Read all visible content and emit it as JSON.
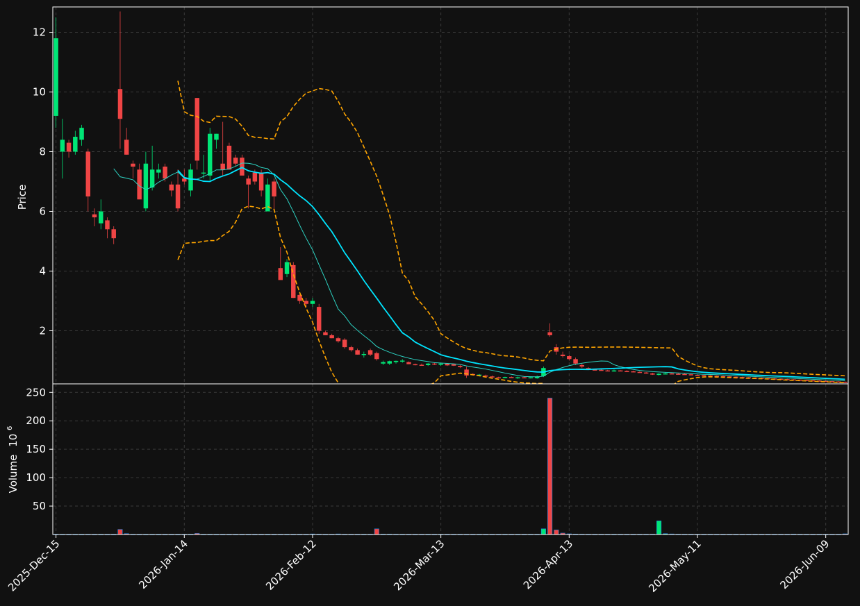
{
  "colors": {
    "background": "#111111",
    "up": "#00e676",
    "down": "#f04545",
    "ma_fast": "#2dd4c4",
    "ma_slow": "#00e5ff",
    "band": "#ffa500",
    "grid": "#3a3a3a",
    "text": "#ffffff",
    "volume_edge": "#1e88e5"
  },
  "chart_data": {
    "type": "candlestick",
    "ylabel": "Price",
    "volume_label": "Volume",
    "volume_exponent_label": "10",
    "volume_exponent_power": "6",
    "x_ticks": [
      {
        "i": 0,
        "label": "2025-Dec-15"
      },
      {
        "i": 20,
        "label": "2026-Jan-14"
      },
      {
        "i": 40,
        "label": "2026-Feb-12"
      },
      {
        "i": 60,
        "label": "2026-Mar-13"
      },
      {
        "i": 80,
        "label": "2026-Apr-13"
      },
      {
        "i": 100,
        "label": "2026-May-11"
      },
      {
        "i": 120,
        "label": "2026-Jun-09"
      }
    ],
    "x_range": [
      -0.5,
      123.5
    ],
    "price_ylim": [
      0.22,
      12.85
    ],
    "price_ticks": [
      2,
      4,
      6,
      8,
      10,
      12
    ],
    "volume_ylim": [
      0,
      265
    ],
    "volume_ticks": [
      50,
      100,
      150,
      200,
      250
    ],
    "grid": true,
    "ohlc": [
      [
        9.2,
        12.5,
        8.8,
        11.8
      ],
      [
        8.0,
        9.1,
        7.1,
        8.4
      ],
      [
        8.3,
        8.4,
        7.8,
        8.0
      ],
      [
        8.0,
        8.7,
        7.9,
        8.5
      ],
      [
        8.4,
        8.9,
        8.2,
        8.8
      ],
      [
        8.0,
        8.1,
        6.0,
        6.5
      ],
      [
        5.9,
        6.1,
        5.5,
        5.8
      ],
      [
        5.6,
        6.4,
        5.4,
        6.0
      ],
      [
        5.7,
        5.8,
        5.1,
        5.4
      ],
      [
        5.4,
        5.5,
        4.9,
        5.1
      ],
      [
        10.1,
        12.7,
        8.1,
        9.1
      ],
      [
        8.4,
        8.8,
        7.9,
        7.9
      ],
      [
        7.6,
        7.7,
        7.1,
        7.5
      ],
      [
        7.4,
        7.6,
        6.5,
        6.4
      ],
      [
        6.1,
        8.0,
        6.0,
        7.6
      ],
      [
        6.8,
        8.2,
        6.7,
        7.4
      ],
      [
        7.3,
        7.6,
        7.1,
        7.4
      ],
      [
        7.5,
        7.6,
        7.0,
        7.1
      ],
      [
        6.9,
        7.0,
        6.5,
        6.7
      ],
      [
        6.9,
        7.4,
        6.0,
        6.1
      ],
      [
        7.1,
        7.4,
        6.9,
        7.0
      ],
      [
        6.7,
        7.6,
        6.5,
        7.4
      ],
      [
        9.8,
        9.8,
        7.4,
        7.7
      ],
      [
        7.3,
        7.9,
        7.1,
        7.3
      ],
      [
        7.2,
        8.8,
        7.0,
        8.6
      ],
      [
        8.4,
        8.6,
        8.1,
        8.6
      ],
      [
        7.6,
        9.0,
        7.2,
        7.4
      ],
      [
        8.2,
        8.3,
        7.4,
        7.4
      ],
      [
        7.8,
        7.9,
        7.5,
        7.6
      ],
      [
        7.8,
        7.9,
        7.2,
        7.2
      ],
      [
        7.1,
        7.2,
        6.1,
        6.9
      ],
      [
        7.3,
        7.4,
        6.9,
        7.0
      ],
      [
        7.3,
        7.4,
        6.5,
        6.7
      ],
      [
        6.0,
        7.1,
        6.0,
        6.9
      ],
      [
        7.0,
        7.1,
        6.0,
        6.5
      ],
      [
        4.1,
        4.8,
        3.8,
        3.7
      ],
      [
        3.9,
        4.4,
        3.8,
        4.3
      ],
      [
        4.2,
        4.3,
        3.1,
        3.1
      ],
      [
        3.2,
        3.3,
        2.9,
        3.0
      ],
      [
        3.0,
        3.1,
        2.8,
        2.9
      ],
      [
        2.9,
        3.1,
        2.8,
        3.0
      ],
      [
        2.8,
        2.9,
        1.9,
        2.0
      ],
      [
        1.95,
        2.0,
        1.85,
        1.85
      ],
      [
        1.85,
        1.9,
        1.75,
        1.75
      ],
      [
        1.75,
        1.8,
        1.6,
        1.65
      ],
      [
        1.7,
        1.75,
        1.4,
        1.45
      ],
      [
        1.45,
        1.5,
        1.3,
        1.35
      ],
      [
        1.35,
        1.4,
        1.2,
        1.2
      ],
      [
        1.2,
        1.3,
        1.1,
        1.22
      ],
      [
        1.35,
        1.4,
        1.15,
        1.2
      ],
      [
        1.25,
        1.3,
        1.0,
        1.05
      ],
      [
        0.9,
        1.0,
        0.85,
        0.95
      ],
      [
        0.9,
        1.0,
        0.85,
        0.98
      ],
      [
        0.95,
        1.0,
        0.9,
        0.99
      ],
      [
        0.97,
        1.05,
        0.93,
        1.0
      ],
      [
        0.95,
        0.97,
        0.88,
        0.88
      ],
      [
        0.88,
        0.9,
        0.84,
        0.86
      ],
      [
        0.86,
        0.9,
        0.83,
        0.85
      ],
      [
        0.85,
        0.92,
        0.82,
        0.9
      ],
      [
        0.9,
        0.94,
        0.85,
        0.87
      ],
      [
        0.86,
        0.92,
        0.82,
        0.9
      ],
      [
        0.9,
        0.91,
        0.82,
        0.84
      ],
      [
        0.88,
        0.9,
        0.82,
        0.83
      ],
      [
        0.82,
        0.85,
        0.75,
        0.78
      ],
      [
        0.7,
        0.8,
        0.42,
        0.5
      ],
      [
        0.55,
        0.58,
        0.5,
        0.52
      ],
      [
        0.52,
        0.55,
        0.49,
        0.53
      ],
      [
        0.5,
        0.53,
        0.48,
        0.49
      ],
      [
        0.47,
        0.5,
        0.44,
        0.46
      ],
      [
        0.44,
        0.46,
        0.41,
        0.42
      ],
      [
        0.43,
        0.46,
        0.41,
        0.45
      ],
      [
        0.45,
        0.47,
        0.42,
        0.43
      ],
      [
        0.41,
        0.46,
        0.39,
        0.44
      ],
      [
        0.44,
        0.46,
        0.41,
        0.42
      ],
      [
        0.42,
        0.45,
        0.4,
        0.44
      ],
      [
        0.41,
        0.5,
        0.39,
        0.47
      ],
      [
        0.48,
        0.8,
        0.45,
        0.75
      ],
      [
        1.95,
        2.25,
        1.8,
        1.85
      ],
      [
        1.45,
        1.55,
        1.2,
        1.3
      ],
      [
        1.2,
        1.3,
        1.1,
        1.15
      ],
      [
        1.15,
        1.2,
        1.0,
        1.05
      ],
      [
        1.05,
        1.1,
        0.85,
        0.9
      ],
      [
        0.85,
        0.9,
        0.75,
        0.8
      ],
      [
        0.75,
        0.78,
        0.7,
        0.72
      ],
      [
        0.7,
        0.73,
        0.68,
        0.69
      ],
      [
        0.69,
        0.71,
        0.66,
        0.67
      ],
      [
        0.67,
        0.69,
        0.64,
        0.66
      ],
      [
        0.66,
        0.7,
        0.63,
        0.67
      ],
      [
        0.67,
        0.68,
        0.64,
        0.65
      ],
      [
        0.65,
        0.68,
        0.63,
        0.64
      ],
      [
        0.64,
        0.66,
        0.61,
        0.62
      ],
      [
        0.62,
        0.64,
        0.59,
        0.6
      ],
      [
        0.6,
        0.62,
        0.56,
        0.57
      ],
      [
        0.57,
        0.59,
        0.52,
        0.53
      ],
      [
        0.52,
        0.58,
        0.5,
        0.56
      ],
      [
        0.56,
        0.6,
        0.54,
        0.57
      ],
      [
        0.57,
        0.6,
        0.55,
        0.56
      ],
      [
        0.56,
        0.58,
        0.54,
        0.55
      ],
      [
        0.55,
        0.57,
        0.53,
        0.54
      ],
      [
        0.54,
        0.56,
        0.51,
        0.52
      ],
      [
        0.52,
        0.53,
        0.5,
        0.51
      ],
      [
        0.51,
        0.52,
        0.49,
        0.5
      ],
      [
        0.5,
        0.51,
        0.48,
        0.49
      ],
      [
        0.49,
        0.5,
        0.47,
        0.48
      ],
      [
        0.48,
        0.5,
        0.46,
        0.47
      ],
      [
        0.47,
        0.48,
        0.45,
        0.46
      ],
      [
        0.46,
        0.47,
        0.44,
        0.45
      ],
      [
        0.45,
        0.46,
        0.43,
        0.44
      ],
      [
        0.44,
        0.45,
        0.42,
        0.43
      ],
      [
        0.43,
        0.44,
        0.41,
        0.42
      ],
      [
        0.42,
        0.43,
        0.4,
        0.41
      ],
      [
        0.41,
        0.42,
        0.39,
        0.4
      ],
      [
        0.4,
        0.41,
        0.38,
        0.39
      ],
      [
        0.39,
        0.4,
        0.37,
        0.38
      ],
      [
        0.38,
        0.39,
        0.36,
        0.37
      ],
      [
        0.37,
        0.38,
        0.35,
        0.36
      ],
      [
        0.36,
        0.37,
        0.34,
        0.35
      ],
      [
        0.35,
        0.36,
        0.33,
        0.34
      ],
      [
        0.34,
        0.35,
        0.32,
        0.33
      ],
      [
        0.33,
        0.34,
        0.31,
        0.32
      ],
      [
        0.32,
        0.33,
        0.3,
        0.31
      ],
      [
        0.31,
        0.32,
        0.29,
        0.3
      ],
      [
        0.3,
        0.31,
        0.28,
        0.29
      ],
      [
        0.29,
        0.3,
        0.27,
        0.28
      ]
    ],
    "volume": [
      0.5,
      0.3,
      0.2,
      0.3,
      0.2,
      0.4,
      0.2,
      0.2,
      0.2,
      0.2,
      9,
      1.5,
      0.4,
      0.3,
      0.3,
      0.3,
      0.2,
      0.2,
      0.2,
      0.2,
      0.2,
      0.3,
      2,
      0.3,
      0.3,
      0.3,
      0.2,
      0.2,
      0.2,
      0.2,
      0.2,
      0.2,
      0.2,
      0.2,
      0.2,
      0.3,
      0.3,
      0.3,
      0.3,
      0.3,
      1,
      0.8,
      0.3,
      0.3,
      1,
      0.3,
      0.3,
      0.3,
      0.3,
      0.3,
      10,
      0.8,
      0.8,
      0.5,
      0.3,
      0.3,
      0.3,
      0.3,
      0.3,
      0.3,
      0.3,
      0.3,
      0.3,
      0.3,
      0.3,
      0.3,
      0.3,
      0.3,
      0.3,
      0.3,
      0.3,
      0.3,
      0.3,
      0.3,
      0.3,
      0.3,
      10,
      240,
      8,
      2.5,
      1.2,
      0.8,
      0.6,
      0.4,
      0.3,
      0.3,
      0.3,
      0.3,
      0.3,
      0.3,
      0.3,
      0.3,
      0.4,
      0.6,
      24,
      1.5,
      1,
      0.6,
      0.4,
      0.3,
      0.3,
      0.3,
      0.3,
      0.3,
      0.3,
      0.3,
      0.3,
      0.3,
      0.3,
      0.3,
      0.3,
      0.3,
      0.3,
      0.3,
      0.3,
      0.8,
      0.3,
      0.3,
      0.3,
      0.3,
      0.3,
      0.3,
      0.3,
      1.2
    ],
    "ma_fast_period": 10,
    "ma_slow_period": 20,
    "band_period": 20,
    "band_std": 2
  }
}
